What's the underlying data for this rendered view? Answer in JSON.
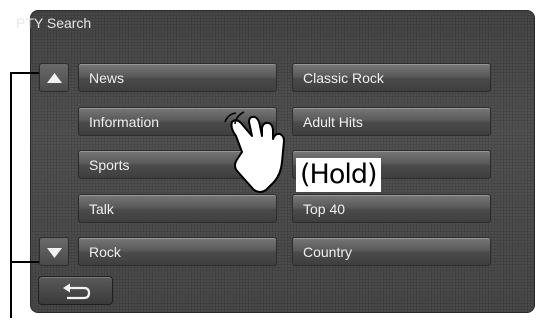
{
  "header": {
    "title": "PTY Search"
  },
  "list": {
    "left": [
      "News",
      "Information",
      "Sports",
      "Talk",
      "Rock"
    ],
    "right": [
      "Classic Rock",
      "Adult Hits",
      "",
      "Top 40",
      "Country"
    ]
  },
  "annotation": {
    "hold": "(Hold)"
  },
  "icons": {
    "scroll_up": "up-triangle-icon",
    "scroll_down": "down-triangle-icon",
    "back": "return-arrow-icon",
    "hand": "pointing-hand-icon"
  }
}
